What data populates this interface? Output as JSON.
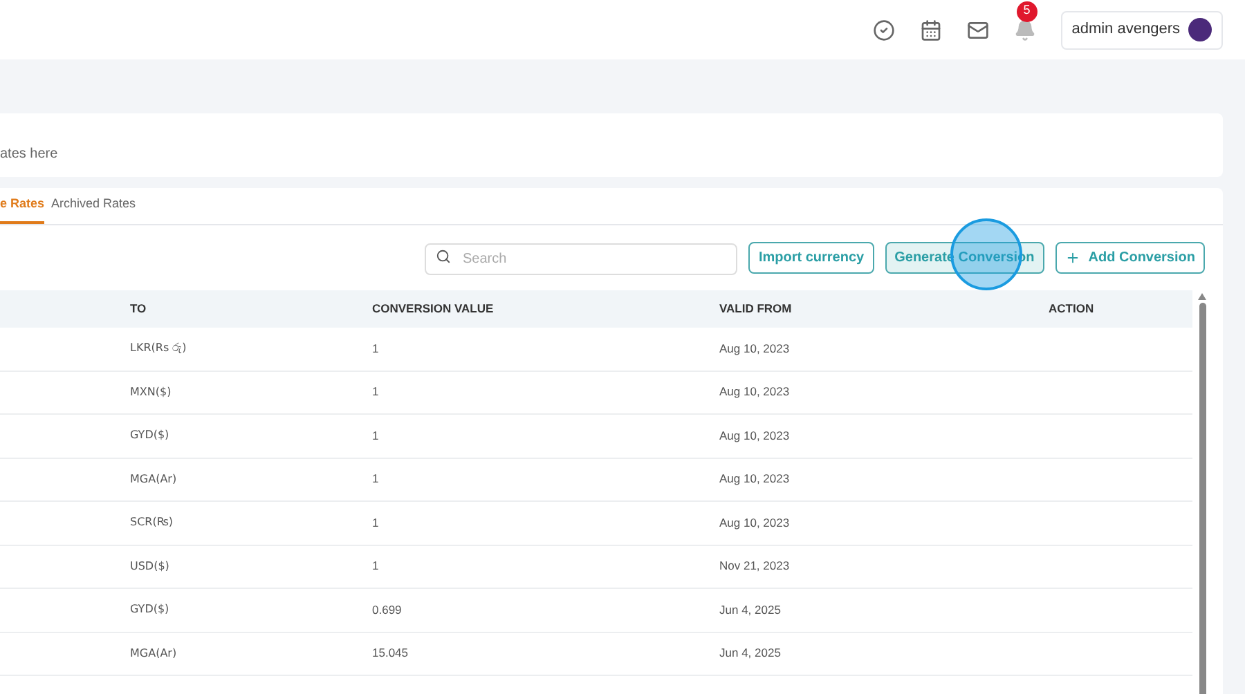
{
  "topbar": {
    "notification_count": "5",
    "user": "admin avengers"
  },
  "info_card": {
    "text": "ates here"
  },
  "tabs": [
    {
      "label": "e Rates",
      "selected": true
    },
    {
      "label": "Archived Rates",
      "selected": false
    }
  ],
  "toolbar": {
    "search": {
      "placeholder": "Search"
    },
    "buttons": [
      {
        "label": "Import currency",
        "kind": "plain"
      },
      {
        "label": "Generate Conversion",
        "kind": "highlighted"
      },
      {
        "label": "Add Conversion",
        "kind": "add"
      }
    ]
  },
  "table": {
    "columns": [
      "TO",
      "CONVERSION VALUE",
      "VALID FROM",
      "ACTION"
    ],
    "rows": [
      {
        "to": "LKR(Rs රු)",
        "value": "1",
        "valid_from": "Aug 10, 2023"
      },
      {
        "to": "MXN($)",
        "value": "1",
        "valid_from": "Aug 10, 2023"
      },
      {
        "to": "GYD($)",
        "value": "1",
        "valid_from": "Aug 10, 2023"
      },
      {
        "to": "MGA(Ar)",
        "value": "1",
        "valid_from": "Aug 10, 2023"
      },
      {
        "to": "SCR(₨)",
        "value": "1",
        "valid_from": "Aug 10, 2023"
      },
      {
        "to": "USD($)",
        "value": "1",
        "valid_from": "Nov 21, 2023"
      },
      {
        "to": "GYD($)",
        "value": "0.699",
        "valid_from": "Jun 4, 2025"
      },
      {
        "to": "MGA(Ar)",
        "value": "15.045",
        "valid_from": "Jun 4, 2025"
      }
    ]
  }
}
